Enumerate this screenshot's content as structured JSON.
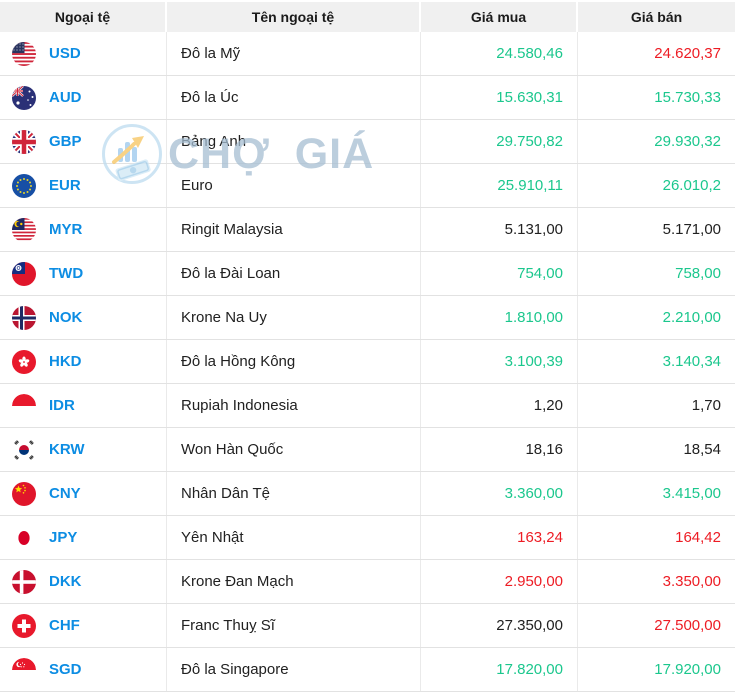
{
  "colors": {
    "blue": "#0d8de3",
    "up": "#1bc78d",
    "down": "#ed1c24",
    "neutral": "#212121",
    "header_bg": "#f0f0f0"
  },
  "watermark": {
    "text": "CHỢ GIÁ",
    "logo_icon": "chogia-logo"
  },
  "table": {
    "columns": [
      {
        "key": "code",
        "label": "Ngoại tệ"
      },
      {
        "key": "name",
        "label": "Tên ngoại tệ"
      },
      {
        "key": "buy",
        "label": "Giá mua"
      },
      {
        "key": "sell",
        "label": "Giá bán"
      }
    ],
    "rows": [
      {
        "code": "USD",
        "flag_icon": "flag-usd",
        "name": "Đô la Mỹ",
        "buy": "24.580,46",
        "buy_trend": "up",
        "sell": "24.620,37",
        "sell_trend": "down"
      },
      {
        "code": "AUD",
        "flag_icon": "flag-aud",
        "name": "Đô la Úc",
        "buy": "15.630,31",
        "buy_trend": "up",
        "sell": "15.730,33",
        "sell_trend": "up"
      },
      {
        "code": "GBP",
        "flag_icon": "flag-gbp",
        "name": "Bảng Anh",
        "buy": "29.750,82",
        "buy_trend": "up",
        "sell": "29.930,32",
        "sell_trend": "up"
      },
      {
        "code": "EUR",
        "flag_icon": "flag-eur",
        "name": "Euro",
        "buy": "25.910,11",
        "buy_trend": "up",
        "sell": "26.010,2",
        "sell_trend": "up"
      },
      {
        "code": "MYR",
        "flag_icon": "flag-myr",
        "name": "Ringit Malaysia",
        "buy": "5.131,00",
        "buy_trend": "neutral",
        "sell": "5.171,00",
        "sell_trend": "neutral"
      },
      {
        "code": "TWD",
        "flag_icon": "flag-twd",
        "name": "Đô la Đài Loan",
        "buy": "754,00",
        "buy_trend": "up",
        "sell": "758,00",
        "sell_trend": "up"
      },
      {
        "code": "NOK",
        "flag_icon": "flag-nok",
        "name": "Krone Na Uy",
        "buy": "1.810,00",
        "buy_trend": "up",
        "sell": "2.210,00",
        "sell_trend": "up"
      },
      {
        "code": "HKD",
        "flag_icon": "flag-hkd",
        "name": "Đô la Hồng Kông",
        "buy": "3.100,39",
        "buy_trend": "up",
        "sell": "3.140,34",
        "sell_trend": "up"
      },
      {
        "code": "IDR",
        "flag_icon": "flag-idr",
        "name": "Rupiah Indonesia",
        "buy": "1,20",
        "buy_trend": "neutral",
        "sell": "1,70",
        "sell_trend": "neutral"
      },
      {
        "code": "KRW",
        "flag_icon": "flag-krw",
        "name": "Won Hàn Quốc",
        "buy": "18,16",
        "buy_trend": "neutral",
        "sell": "18,54",
        "sell_trend": "neutral"
      },
      {
        "code": "CNY",
        "flag_icon": "flag-cny",
        "name": "Nhân Dân Tệ",
        "buy": "3.360,00",
        "buy_trend": "up",
        "sell": "3.415,00",
        "sell_trend": "up"
      },
      {
        "code": "JPY",
        "flag_icon": "flag-jpy",
        "name": "Yên Nhật",
        "buy": "163,24",
        "buy_trend": "down",
        "sell": "164,42",
        "sell_trend": "down"
      },
      {
        "code": "DKK",
        "flag_icon": "flag-dkk",
        "name": "Krone Đan Mạch",
        "buy": "2.950,00",
        "buy_trend": "down",
        "sell": "3.350,00",
        "sell_trend": "down"
      },
      {
        "code": "CHF",
        "flag_icon": "flag-chf",
        "name": "Franc Thuỵ Sĩ",
        "buy": "27.350,00",
        "buy_trend": "neutral",
        "sell": "27.500,00",
        "sell_trend": "down"
      },
      {
        "code": "SGD",
        "flag_icon": "flag-sgd",
        "name": "Đô la Singapore",
        "buy": "17.820,00",
        "buy_trend": "up",
        "sell": "17.920,00",
        "sell_trend": "up"
      }
    ]
  }
}
